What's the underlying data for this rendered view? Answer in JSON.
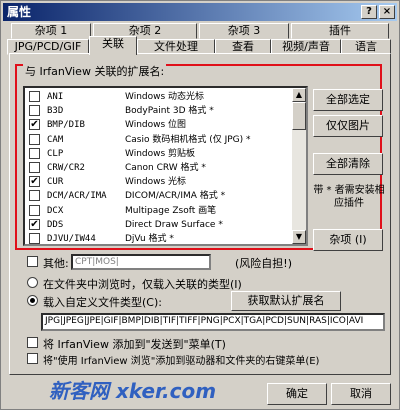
{
  "window": {
    "title": "属性",
    "help_btn": "?",
    "close_btn": "×"
  },
  "tabs_row1": [
    "杂项 1",
    "杂项 2",
    "杂项 3",
    "插件"
  ],
  "tabs_row2": [
    "JPG/PCD/GIF",
    "关联",
    "文件处理",
    "查看",
    "视频/声音",
    "语言"
  ],
  "group_label": "与 IrfanView 关联的扩展名:",
  "list": [
    {
      "ext": "ANI",
      "desc": "Windows 动态光标",
      "checked": false
    },
    {
      "ext": "B3D",
      "desc": "BodyPaint 3D 格式 *",
      "checked": false
    },
    {
      "ext": "BMP/DIB",
      "desc": "Windows 位图",
      "checked": true
    },
    {
      "ext": "CAM",
      "desc": "Casio 数码相机格式 (仅 JPG) *",
      "checked": false
    },
    {
      "ext": "CLP",
      "desc": "Windows 剪贴板",
      "checked": false
    },
    {
      "ext": "CRW/CR2",
      "desc": "Canon CRW 格式 *",
      "checked": false
    },
    {
      "ext": "CUR",
      "desc": "Windows 光标",
      "checked": true
    },
    {
      "ext": "DCM/ACR/IMA",
      "desc": "DICOM/ACR/IMA 格式 *",
      "checked": false
    },
    {
      "ext": "DCX",
      "desc": "Multipage Zsoft 画笔",
      "checked": false
    },
    {
      "ext": "DDS",
      "desc": "Direct Draw Surface *",
      "checked": true
    },
    {
      "ext": "DJVU/IW44",
      "desc": "DjVu 格式 *",
      "checked": false
    }
  ],
  "buttons": {
    "select_all": "全部选定",
    "images_only": "仅仅图片",
    "clear_all": "全部清除",
    "misc": "杂项 (I)",
    "get_default": "获取默认扩展名",
    "ok": "确定",
    "cancel": "取消"
  },
  "note": "带 * 者需安装相应插件",
  "other": {
    "label": "其他:",
    "value": "CPT|MOS|",
    "risk": "(风险自担!)"
  },
  "radio1": "在文件夹中浏览时，仅载入关联的类型(I)",
  "radio2": "载入自定义文件类型(C):",
  "custom_types": "JPG|JPEG|JPE|GIF|BMP|DIB|TIF|TIFF|PNG|PCX|TGA|PCD|SUN|RAS|ICO|AVI",
  "option1": "将 IrfanView 添加到\"发送到\"菜单(T)",
  "option2": "将\"使用 IrfanView 浏览\"添加到驱动器和文件夹的右键菜单(E)",
  "watermark": "新客网 xker.com"
}
